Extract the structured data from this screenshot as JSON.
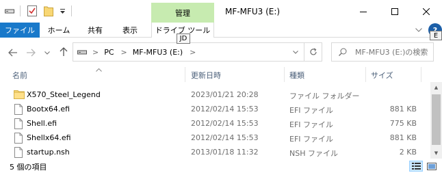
{
  "titlebar": {
    "manage_label": "管理",
    "window_title": "MF-MFU3 (E:)",
    "minimize": "—",
    "maximize": "☐",
    "close": "✕"
  },
  "ribbon": {
    "tabs": [
      {
        "label": "ファイル"
      },
      {
        "label": "ホーム"
      },
      {
        "label": "共有"
      },
      {
        "label": "表示"
      },
      {
        "label": "ドライブ ツール"
      }
    ],
    "expand_icon": "chevron-down-icon",
    "help_badge": "E"
  },
  "tooltip": {
    "text": "JD"
  },
  "nav": {
    "back": "←",
    "forward": "→",
    "recent": "⌄",
    "up": "↑"
  },
  "address": {
    "crumbs": [
      "PC",
      "MF-MFU3 (E:)"
    ],
    "separator": ">"
  },
  "search": {
    "placeholder": "MF-MFU3 (E:)の検索"
  },
  "columns": {
    "name": "名前",
    "date": "更新日時",
    "type": "種類",
    "size": "サイズ"
  },
  "files": [
    {
      "name": "X570_Steel_Legend",
      "date": "2023/01/21 20:28",
      "type": "ファイル フォルダー",
      "size": "",
      "icon": "folder-icon"
    },
    {
      "name": "Bootx64.efi",
      "date": "2012/02/14 15:53",
      "type": "EFI ファイル",
      "size": "881 KB",
      "icon": "file-icon"
    },
    {
      "name": "Shell.efi",
      "date": "2012/02/14 15:53",
      "type": "EFI ファイル",
      "size": "775 KB",
      "icon": "file-icon"
    },
    {
      "name": "Shellx64.efi",
      "date": "2012/02/14 15:53",
      "type": "EFI ファイル",
      "size": "881 KB",
      "icon": "file-icon"
    },
    {
      "name": "startup.nsh",
      "date": "2013/01/18 11:32",
      "type": "NSH ファイル",
      "size": "2 KB",
      "icon": "file-icon"
    }
  ],
  "status": {
    "item_count": "5 個の項目"
  },
  "colors": {
    "file_tab": "#1979ca",
    "manage_tab": "#c7ebb0",
    "folder": "#f8d775",
    "selected_view": "#cce8ff"
  }
}
